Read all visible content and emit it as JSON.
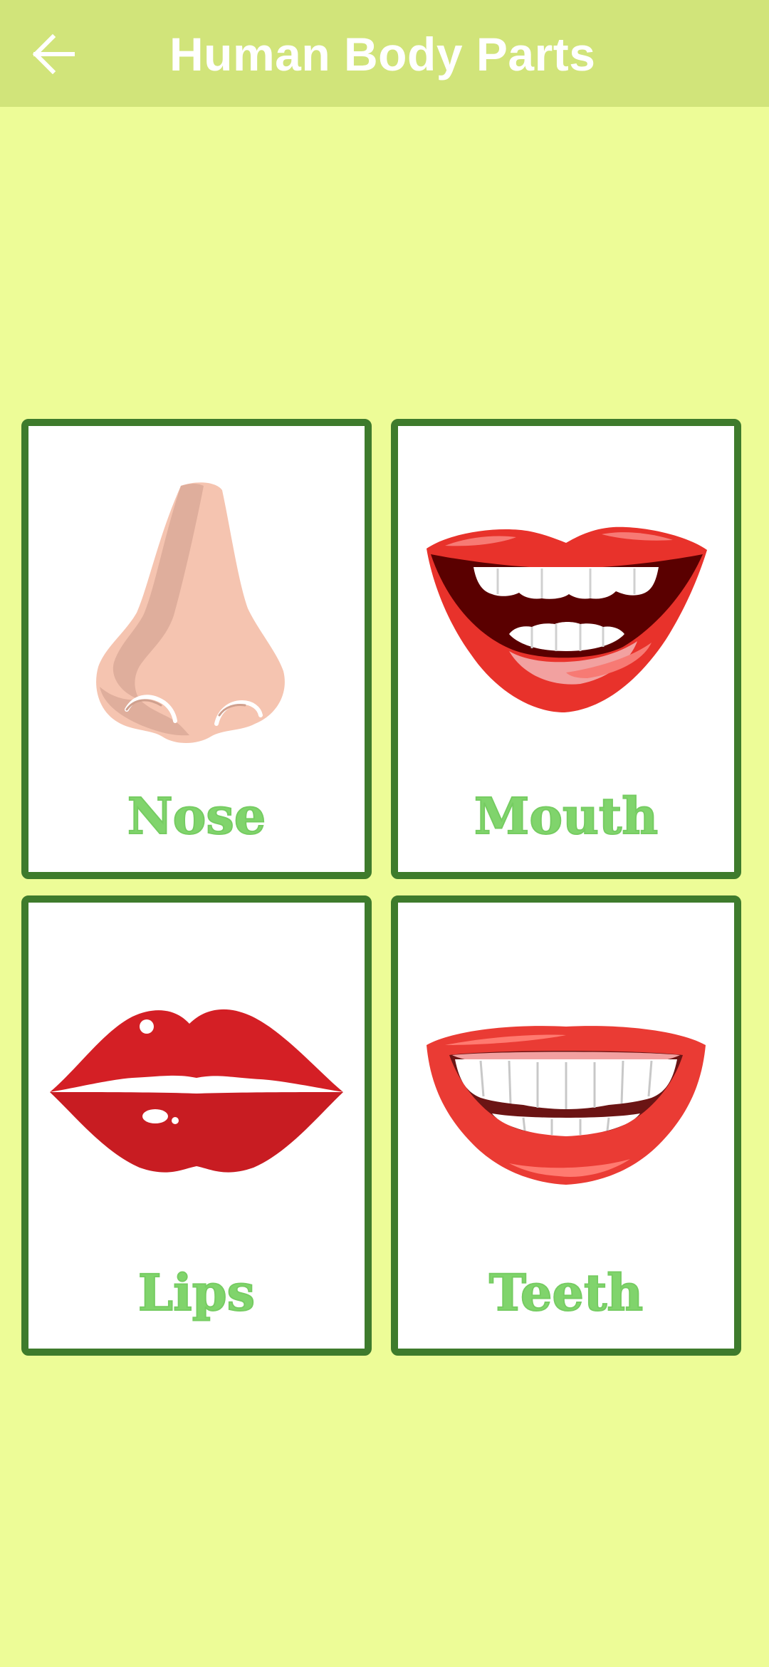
{
  "app_bar": {
    "title": "Human Body Parts",
    "back_icon": "arrow-left-icon",
    "background": "#d1e47a"
  },
  "page": {
    "background": "#edfc97"
  },
  "cards": [
    {
      "label": "Nose",
      "image": "nose-illustration"
    },
    {
      "label": "Mouth",
      "image": "mouth-illustration"
    },
    {
      "label": "Lips",
      "image": "lips-illustration"
    },
    {
      "label": "Teeth",
      "image": "teeth-illustration"
    }
  ],
  "colors": {
    "card_border": "#3e7b2c",
    "label": "#80d46c",
    "lip_red": "#e8322b"
  }
}
